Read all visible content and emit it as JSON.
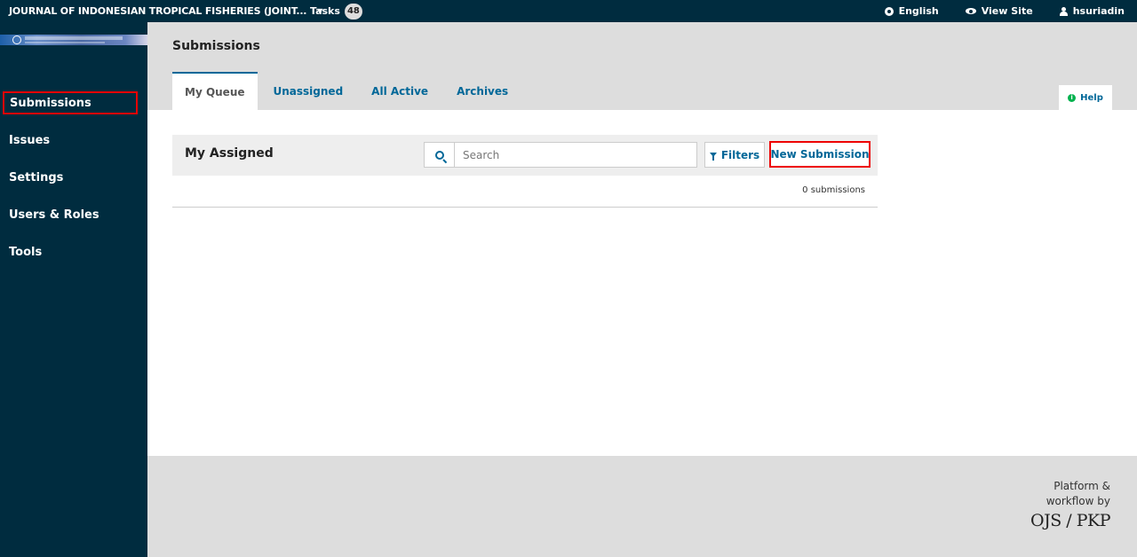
{
  "topbar": {
    "context": "JOURNAL OF INDONESIAN TROPICAL FISHERIES (JOINT...",
    "tasks_label": "Tasks",
    "tasks_count": "48",
    "language": "English",
    "view_site": "View Site",
    "username": "hsuriadin"
  },
  "sidebar": {
    "items": [
      {
        "label": "Submissions"
      },
      {
        "label": "Issues"
      },
      {
        "label": "Settings"
      },
      {
        "label": "Users & Roles"
      },
      {
        "label": "Tools"
      }
    ]
  },
  "header": {
    "title": "Submissions",
    "tabs": [
      {
        "label": "My Queue"
      },
      {
        "label": "Unassigned"
      },
      {
        "label": "All Active"
      },
      {
        "label": "Archives"
      }
    ],
    "help": "Help"
  },
  "panel": {
    "title": "My Assigned",
    "search_placeholder": "Search",
    "filters": "Filters",
    "new_submission": "New Submission",
    "count": "0 submissions"
  },
  "footer": {
    "line1": "Platform &",
    "line2": "workflow by",
    "logo": "OJS / PKP"
  },
  "colors": {
    "nav_bg": "#002c3f",
    "link": "#006798",
    "highlight": "#ee0000"
  }
}
